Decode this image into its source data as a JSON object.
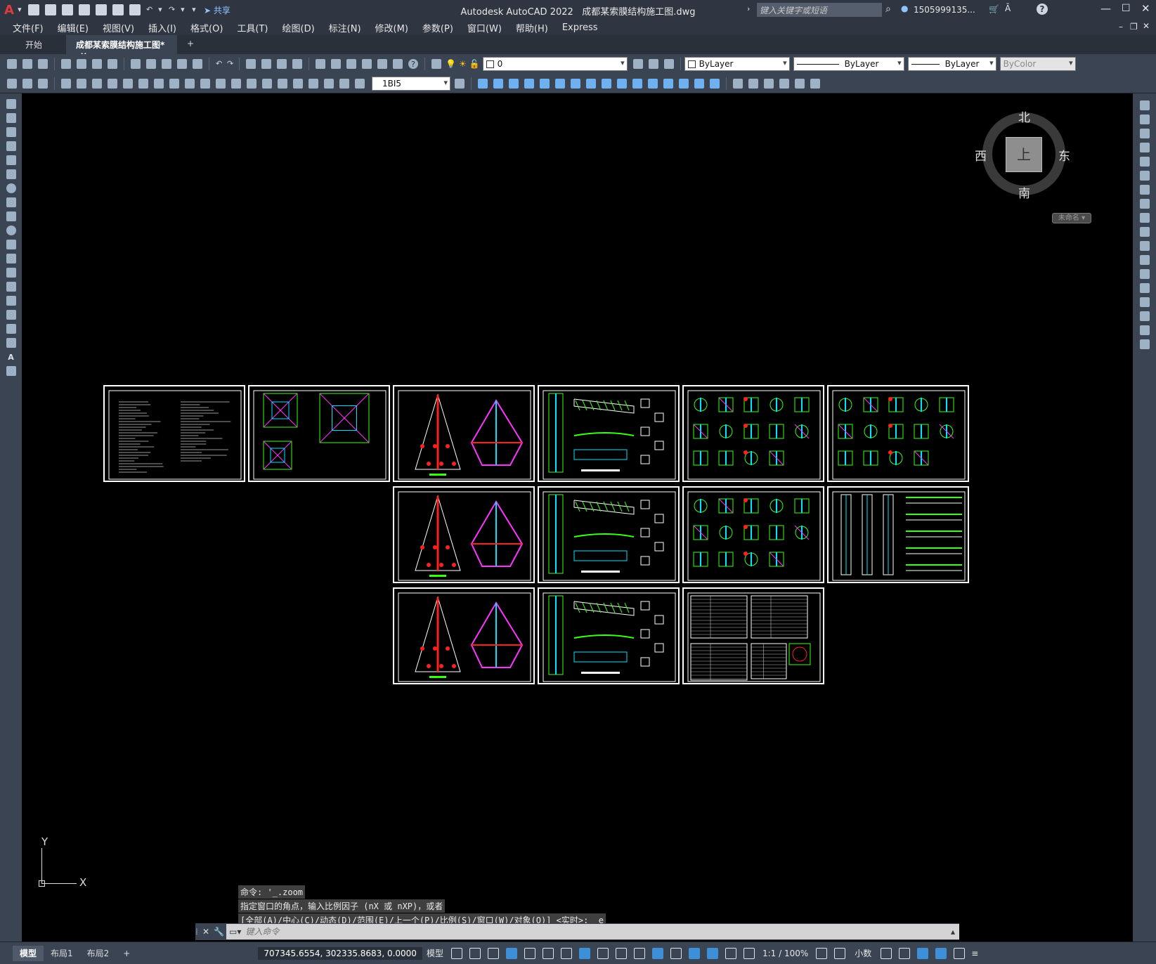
{
  "title": {
    "app": "Autodesk AutoCAD 2022",
    "file": "成都某索膜结构施工图.dwg",
    "search_placeholder": "键入关键字或短语",
    "user": "1505999135...",
    "share_label": "共享"
  },
  "menu": [
    "文件(F)",
    "编辑(E)",
    "视图(V)",
    "插入(I)",
    "格式(O)",
    "工具(T)",
    "绘图(D)",
    "标注(N)",
    "修改(M)",
    "参数(P)",
    "窗口(W)",
    "帮助(H)",
    "Express"
  ],
  "tabs": {
    "start": "开始",
    "drawing": "成都某索膜结构施工图*",
    "add": "+"
  },
  "toolbar": {
    "layer_value": "0",
    "color_value": "ByLayer",
    "linetype_value": "ByLayer",
    "lineweight_value": "ByLayer",
    "plotstyle_value": "ByColor",
    "dimstyle_value": "1BI5"
  },
  "viewcube": {
    "north": "北",
    "south": "南",
    "east": "东",
    "west": "西",
    "top": "上",
    "wcs": "未命名"
  },
  "ucs": {
    "y_label": "Y",
    "x_label": "X"
  },
  "command": {
    "history": [
      "命令: '_.zoom",
      "指定窗口的角点，输入比例因子 (nX 或 nXP)，或者",
      "[全部(A)/中心(C)/动态(D)/范围(E)/上一个(P)/比例(S)/窗口(W)/对象(O)] <实时>: _e"
    ],
    "placeholder": "键入命令"
  },
  "status": {
    "tabs": [
      "模型",
      "布局1",
      "布局2"
    ],
    "coords": "707345.6554, 302335.8683, 0.0000",
    "model_label": "模型",
    "scale": "1:1 / 100%",
    "units": "小数"
  },
  "colors": {
    "accent": "#3d8fd8",
    "sheet_border": "#ffffff",
    "geom_green": "#39ff14",
    "geom_cyan": "#00e5ff",
    "geom_magenta": "#ff33ff",
    "geom_red": "#ff2020"
  }
}
